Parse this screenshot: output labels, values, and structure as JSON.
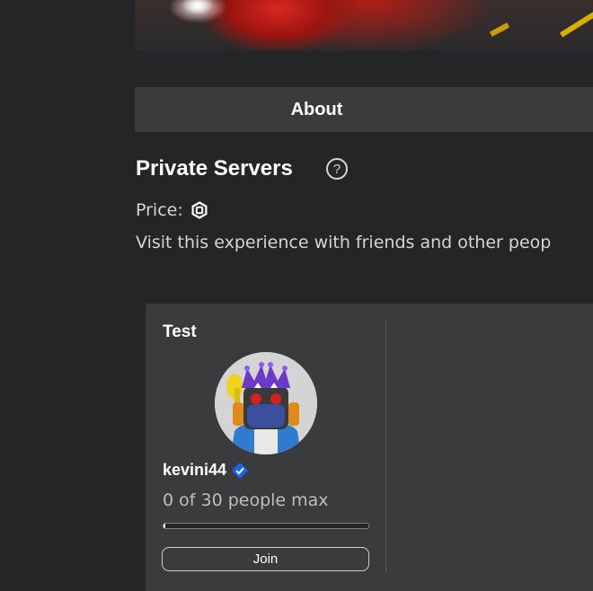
{
  "tabs": {
    "about_label": "About"
  },
  "private_servers": {
    "title": "Private Servers",
    "help_icon": "question-circle-icon",
    "price_label": "Price:",
    "price_icon": "robux-icon",
    "description": "Visit this experience with friends and other peop"
  },
  "server_card": {
    "name": "Test",
    "owner_name": "kevini44",
    "verified_icon": "verified-badge-icon",
    "capacity_text": "0 of 30 people max",
    "occupancy_fraction": 0.0,
    "join_label": "Join"
  },
  "colors": {
    "background": "#232527",
    "panel": "#393b3d",
    "verified_blue": "#1b63f5",
    "text_secondary": "#d5d5d5"
  }
}
